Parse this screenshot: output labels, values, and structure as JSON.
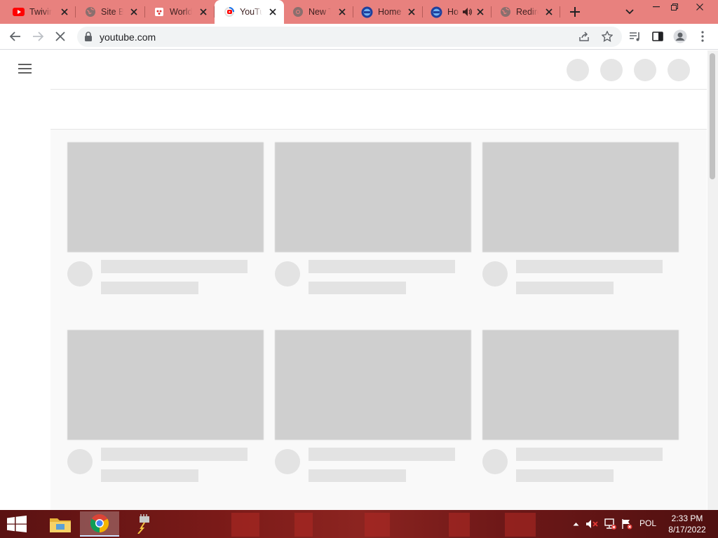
{
  "browser": {
    "tabs": [
      {
        "title": "Twivin",
        "favicon": "youtube-icon",
        "active": false
      },
      {
        "title": "Site Bl",
        "favicon": "globe-icon",
        "active": false
      },
      {
        "title": "World",
        "favicon": "cards-icon",
        "active": false
      },
      {
        "title": "YouTul",
        "favicon": "youtube-loading-icon",
        "active": true
      },
      {
        "title": "New T",
        "favicon": "chrome-icon",
        "active": false
      },
      {
        "title": "Home",
        "favicon": "pbs-kids-icon",
        "active": false
      },
      {
        "title": "Ho",
        "favicon": "pbs-kids-icon",
        "active": false,
        "audio": true
      },
      {
        "title": "Redire",
        "favicon": "globe-icon",
        "active": false
      }
    ],
    "address_bar": {
      "url": "youtube.com"
    }
  },
  "colors": {
    "tabstrip": "#e8817e",
    "skeleton": "#cfcfcf",
    "skeleton_light": "#e3e3e3",
    "feed_bg": "#f9f9f9"
  },
  "taskbar": {
    "apps": [
      "file-explorer-icon",
      "chrome-icon",
      "network-tool-icon"
    ],
    "language": "POL",
    "time": "2:33 PM",
    "date": "8/17/2022"
  }
}
